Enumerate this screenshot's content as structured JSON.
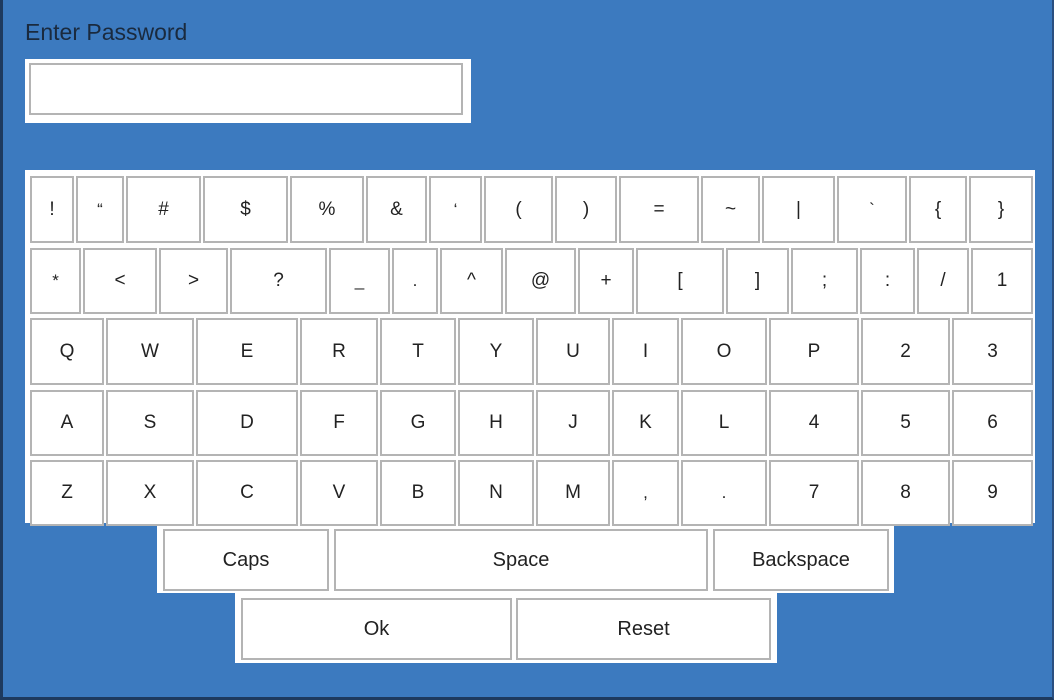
{
  "title": "Enter Password",
  "password": {
    "value": ""
  },
  "keyboard": {
    "rows": [
      [
        "!",
        "“",
        "#",
        "$",
        "%",
        "&",
        "‘",
        "(",
        ")",
        "=",
        "~",
        "|",
        "`",
        "{",
        "}"
      ],
      [
        "*",
        "<",
        ">",
        "?",
        "_",
        ".",
        "^",
        "@",
        "+",
        "[",
        "]",
        ";",
        ":",
        "/",
        "1"
      ],
      [
        "Q",
        "W",
        "E",
        "R",
        "T",
        "Y",
        "U",
        "I",
        "O",
        "P",
        "2",
        "3"
      ],
      [
        "A",
        "S",
        "D",
        "F",
        "G",
        "H",
        "J",
        "K",
        "L",
        "4",
        "5",
        "6"
      ],
      [
        "Z",
        "X",
        "C",
        "V",
        "B",
        "N",
        "M",
        ",",
        ".",
        "7",
        "8",
        "9"
      ]
    ],
    "caps_label": "Caps",
    "space_label": "Space",
    "backspace_label": "Backspace",
    "ok_label": "Ok",
    "reset_label": "Reset"
  }
}
